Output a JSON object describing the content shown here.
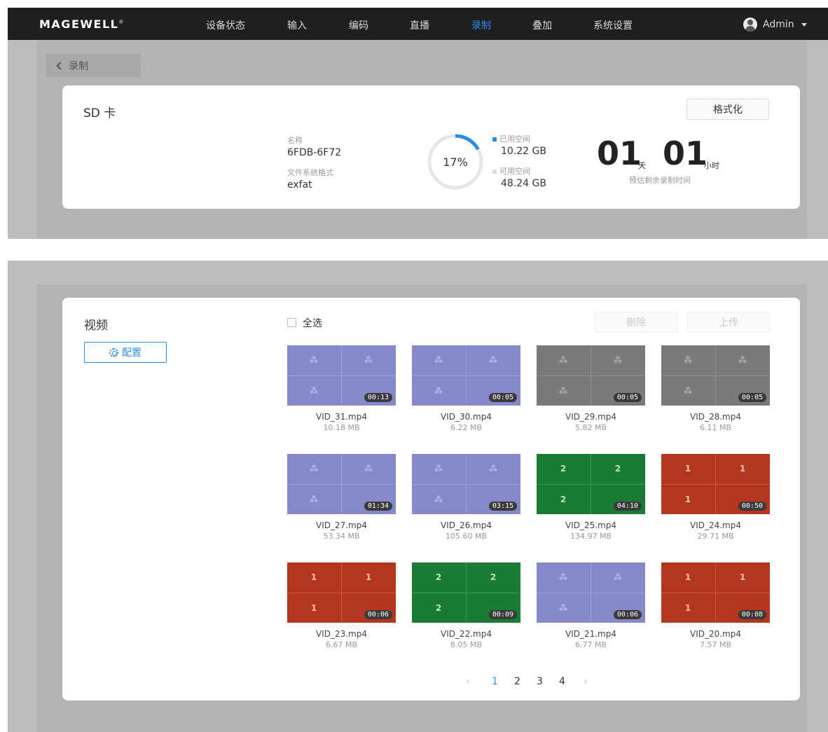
{
  "navbar": {
    "logo": "MAGEWELL",
    "items": [
      "设备状态",
      "输入",
      "编码",
      "直播",
      "录制",
      "叠加",
      "系统设置"
    ],
    "active_index": 4,
    "user": "Admin"
  },
  "back_label": "录制",
  "sd_card": {
    "title": "SD 卡",
    "format_button": "格式化",
    "name_label": "名称",
    "name_value": "6FDB-6F72",
    "fs_label": "文件系统格式",
    "fs_value": "exfat",
    "usage_percent": 17,
    "usage_text": "17%",
    "used_label": "已用空间",
    "used_value": "10.22 GB",
    "available_label": "可用空间",
    "available_value": "48.24 GB",
    "days": "01",
    "days_unit": "天",
    "hours": "01",
    "hours_unit": "小时",
    "remaining_label": "预估剩余录制时间",
    "colors": {
      "used": "#2b8cf0",
      "free": "#e6e6e6"
    }
  },
  "videos": {
    "title": "视频",
    "config_button": "配置",
    "select_all": "全选",
    "delete_button": "删除",
    "upload_button": "上传",
    "items": [
      {
        "name": "VID_31.mp4",
        "size": "10.18 MB",
        "duration": "00:13",
        "theme": "purple"
      },
      {
        "name": "VID_30.mp4",
        "size": "6.22 MB",
        "duration": "00:05",
        "theme": "purple"
      },
      {
        "name": "VID_29.mp4",
        "size": "5.82 MB",
        "duration": "00:05",
        "theme": "gray"
      },
      {
        "name": "VID_28.mp4",
        "size": "6.11 MB",
        "duration": "00:05",
        "theme": "gray"
      },
      {
        "name": "VID_27.mp4",
        "size": "53.34 MB",
        "duration": "01:34",
        "theme": "purple"
      },
      {
        "name": "VID_26.mp4",
        "size": "105.60 MB",
        "duration": "03:15",
        "theme": "purple"
      },
      {
        "name": "VID_25.mp4",
        "size": "134.97 MB",
        "duration": "04:10",
        "theme": "green"
      },
      {
        "name": "VID_24.mp4",
        "size": "29.71 MB",
        "duration": "00:50",
        "theme": "red"
      },
      {
        "name": "VID_23.mp4",
        "size": "6.67 MB",
        "duration": "00:06",
        "theme": "red"
      },
      {
        "name": "VID_22.mp4",
        "size": "8.05 MB",
        "duration": "00:09",
        "theme": "green"
      },
      {
        "name": "VID_21.mp4",
        "size": "6.77 MB",
        "duration": "00:06",
        "theme": "purple"
      },
      {
        "name": "VID_20.mp4",
        "size": "7.57 MB",
        "duration": "00:08",
        "theme": "red"
      }
    ]
  },
  "pagination": {
    "pages": [
      "1",
      "2",
      "3",
      "4"
    ],
    "current": "1",
    "prev_icon": "‹",
    "next_icon": "›"
  }
}
